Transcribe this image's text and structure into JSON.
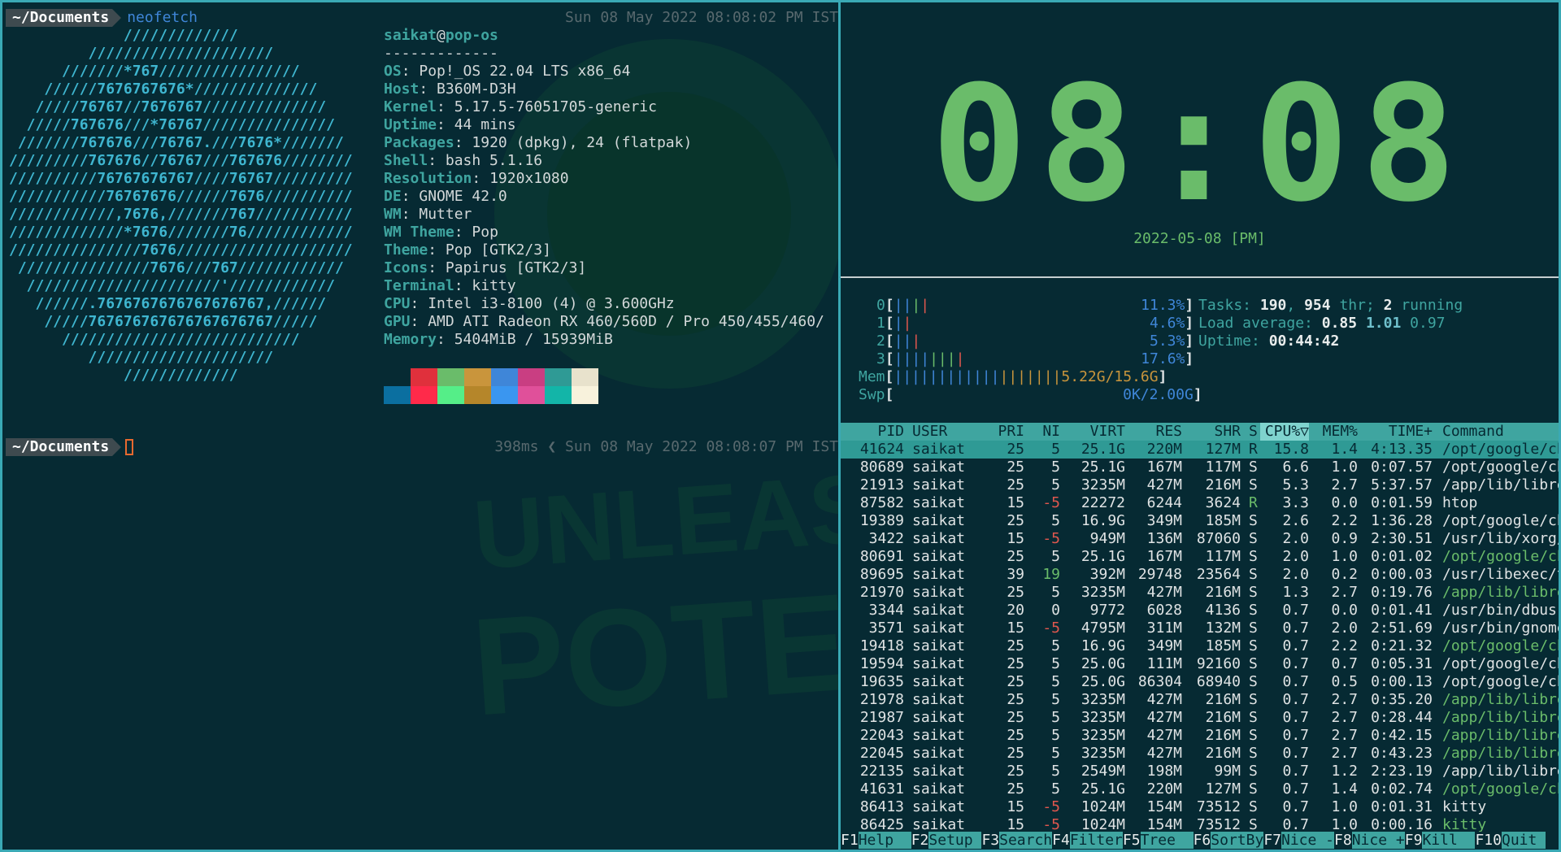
{
  "left_terminal": {
    "prompt_dir": "~/Documents",
    "command": "neofetch",
    "timestamp1": "Sun 08 May 2022 08:08:02 PM IST",
    "duration": "398ms",
    "timestamp2": "Sun 08 May 2022 08:08:07 PM IST",
    "separator_glyph": "❮",
    "ascii_art": [
      "             /////////////",
      "         /////////////////////",
      "      ///////*767////////////////",
      "    //////7676767676*//////////////",
      "   /////76767//7676767//////////////",
      "  /////767676///*76767///////////////",
      " ///////767676///76767.///7676*///////",
      "/////////767676//76767///767676////////",
      "//////////76767676767////76767/////////",
      "///////////76767676//////7676//////////",
      "////////////,7676,///////767///////////",
      "/////////////*7676///////76////////////",
      "///////////////7676////////////////////",
      " ///////////////7676///767////////////",
      "  //////////////////////'////////////",
      "   //////.7676767676767676767,//////",
      "    /////767676767676767676767/////",
      "      ///////////////////////////",
      "         /////////////////////",
      "             /////////////"
    ],
    "user": "saikat",
    "host": "pop-os",
    "divider": "-------------",
    "info": [
      {
        "key": "OS",
        "value": "Pop!_OS 22.04 LTS x86_64"
      },
      {
        "key": "Host",
        "value": "B360M-D3H"
      },
      {
        "key": "Kernel",
        "value": "5.17.5-76051705-generic"
      },
      {
        "key": "Uptime",
        "value": "44 mins"
      },
      {
        "key": "Packages",
        "value": "1920 (dpkg), 24 (flatpak)"
      },
      {
        "key": "Shell",
        "value": "bash 5.1.16"
      },
      {
        "key": "Resolution",
        "value": "1920x1080"
      },
      {
        "key": "DE",
        "value": "GNOME 42.0"
      },
      {
        "key": "WM",
        "value": "Mutter"
      },
      {
        "key": "WM Theme",
        "value": "Pop"
      },
      {
        "key": "Theme",
        "value": "Pop [GTK2/3]"
      },
      {
        "key": "Icons",
        "value": "Papirus [GTK2/3]"
      },
      {
        "key": "Terminal",
        "value": "kitty"
      },
      {
        "key": "CPU",
        "value": "Intel i3-8100 (4) @ 3.600GHz"
      },
      {
        "key": "GPU",
        "value": "AMD ATI Radeon RX 460/560D / Pro 450/455/460/"
      },
      {
        "key": "Memory",
        "value": "5404MiB / 15939MiB"
      }
    ],
    "palette_top": [
      "#062a33",
      "#e0303c",
      "#6abc6a",
      "#c9953c",
      "#3f86d8",
      "#c93e82",
      "#2f9a95",
      "#e8e2cc"
    ],
    "palette_bottom": [
      "#0b6fa0",
      "#ff2a4a",
      "#55ee88",
      "#b5862a",
      "#3a96f0",
      "#e0509a",
      "#13b5a8",
      "#f8f2dc"
    ],
    "watermark_text": [
      "UNLEASH YOUR",
      "POTENTIAL"
    ]
  },
  "clock": {
    "time": "08:08",
    "date": "2022-05-08 [PM]"
  },
  "htop": {
    "cpus": [
      {
        "id": "0",
        "pct": "11.3%",
        "fill": 0.113,
        "bars": "||||"
      },
      {
        "id": "1",
        "pct": "4.6%",
        "fill": 0.046,
        "bars": "||"
      },
      {
        "id": "2",
        "pct": "5.3%",
        "fill": 0.053,
        "bars": "|||"
      },
      {
        "id": "3",
        "pct": "17.6%",
        "fill": 0.176,
        "bars": "||||||||"
      }
    ],
    "mem": {
      "label": "Mem",
      "value": "5.22G/15.6G",
      "bars": "|||||||||||||||||||"
    },
    "swp": {
      "label": "Swp",
      "value": "0K/2.00G"
    },
    "tasks": {
      "label": "Tasks:",
      "count": "190",
      "thr": "954",
      "thr_label": "thr;",
      "running": "2",
      "running_label": "running"
    },
    "load": {
      "label": "Load average:",
      "v1": "0.85",
      "v2": "1.01",
      "v3": "0.97"
    },
    "uptime": {
      "label": "Uptime:",
      "value": "00:44:42"
    },
    "columns": {
      "pid": "PID",
      "user": "USER",
      "pri": "PRI",
      "ni": "NI",
      "virt": "VIRT",
      "res": "RES",
      "shr": "SHR",
      "s": "S",
      "cpu": "CPU%▽",
      "mem": "MEM%",
      "time": "TIME+",
      "cmd": "Command"
    },
    "processes": [
      {
        "pid": "41624",
        "user": "saikat",
        "pri": "25",
        "ni": "5",
        "virt": "25.1G",
        "res": "220M",
        "shr": "127M",
        "s": "R",
        "cpu": "15.8",
        "mem": "1.4",
        "time": "4:13.35",
        "cmd": "/opt/google/chr"
      },
      {
        "pid": "80689",
        "user": "saikat",
        "pri": "25",
        "ni": "5",
        "virt": "25.1G",
        "res": "167M",
        "shr": "117M",
        "s": "S",
        "cpu": "6.6",
        "mem": "1.0",
        "time": "0:07.57",
        "cmd": "/opt/google/chr"
      },
      {
        "pid": "21913",
        "user": "saikat",
        "pri": "25",
        "ni": "5",
        "virt": "3235M",
        "res": "427M",
        "shr": "216M",
        "s": "S",
        "cpu": "5.3",
        "mem": "2.7",
        "time": "5:37.57",
        "cmd": "/app/lib/librew"
      },
      {
        "pid": "87582",
        "user": "saikat",
        "pri": "15",
        "ni": "-5",
        "virt": "22272",
        "res": "6244",
        "shr": "3624",
        "s": "R",
        "cpu": "3.3",
        "mem": "0.0",
        "time": "0:01.59",
        "cmd": "htop"
      },
      {
        "pid": "19389",
        "user": "saikat",
        "pri": "25",
        "ni": "5",
        "virt": "16.9G",
        "res": "349M",
        "shr": "185M",
        "s": "S",
        "cpu": "2.6",
        "mem": "2.2",
        "time": "1:36.28",
        "cmd": "/opt/google/chr"
      },
      {
        "pid": "3422",
        "user": "saikat",
        "pri": "15",
        "ni": "-5",
        "virt": "949M",
        "res": "136M",
        "shr": "87060",
        "s": "S",
        "cpu": "2.0",
        "mem": "0.9",
        "time": "2:30.51",
        "cmd": "/usr/lib/xorg/X"
      },
      {
        "pid": "80691",
        "user": "saikat",
        "pri": "25",
        "ni": "5",
        "virt": "25.1G",
        "res": "167M",
        "shr": "117M",
        "s": "S",
        "cpu": "2.0",
        "mem": "1.0",
        "time": "0:01.02",
        "cmd": "/opt/google/chr"
      },
      {
        "pid": "89695",
        "user": "saikat",
        "pri": "39",
        "ni": "19",
        "virt": "392M",
        "res": "29748",
        "shr": "23564",
        "s": "S",
        "cpu": "2.0",
        "mem": "0.2",
        "time": "0:00.03",
        "cmd": "/usr/libexec/tr"
      },
      {
        "pid": "21970",
        "user": "saikat",
        "pri": "25",
        "ni": "5",
        "virt": "3235M",
        "res": "427M",
        "shr": "216M",
        "s": "S",
        "cpu": "1.3",
        "mem": "2.7",
        "time": "0:19.76",
        "cmd": "/app/lib/librew"
      },
      {
        "pid": "3344",
        "user": "saikat",
        "pri": "20",
        "ni": "0",
        "virt": "9772",
        "res": "6028",
        "shr": "4136",
        "s": "S",
        "cpu": "0.7",
        "mem": "0.0",
        "time": "0:01.41",
        "cmd": "/usr/bin/dbus-d"
      },
      {
        "pid": "3571",
        "user": "saikat",
        "pri": "15",
        "ni": "-5",
        "virt": "4795M",
        "res": "311M",
        "shr": "132M",
        "s": "S",
        "cpu": "0.7",
        "mem": "2.0",
        "time": "2:51.69",
        "cmd": "/usr/bin/gnome-"
      },
      {
        "pid": "19418",
        "user": "saikat",
        "pri": "25",
        "ni": "5",
        "virt": "16.9G",
        "res": "349M",
        "shr": "185M",
        "s": "S",
        "cpu": "0.7",
        "mem": "2.2",
        "time": "0:21.32",
        "cmd": "/opt/google/chr"
      },
      {
        "pid": "19594",
        "user": "saikat",
        "pri": "25",
        "ni": "5",
        "virt": "25.0G",
        "res": "111M",
        "shr": "92160",
        "s": "S",
        "cpu": "0.7",
        "mem": "0.7",
        "time": "0:05.31",
        "cmd": "/opt/google/chr"
      },
      {
        "pid": "19635",
        "user": "saikat",
        "pri": "25",
        "ni": "5",
        "virt": "25.0G",
        "res": "86304",
        "shr": "68940",
        "s": "S",
        "cpu": "0.7",
        "mem": "0.5",
        "time": "0:00.13",
        "cmd": "/opt/google/chr"
      },
      {
        "pid": "21978",
        "user": "saikat",
        "pri": "25",
        "ni": "5",
        "virt": "3235M",
        "res": "427M",
        "shr": "216M",
        "s": "S",
        "cpu": "0.7",
        "mem": "2.7",
        "time": "0:35.20",
        "cmd": "/app/lib/librew"
      },
      {
        "pid": "21987",
        "user": "saikat",
        "pri": "25",
        "ni": "5",
        "virt": "3235M",
        "res": "427M",
        "shr": "216M",
        "s": "S",
        "cpu": "0.7",
        "mem": "2.7",
        "time": "0:28.44",
        "cmd": "/app/lib/librew"
      },
      {
        "pid": "22043",
        "user": "saikat",
        "pri": "25",
        "ni": "5",
        "virt": "3235M",
        "res": "427M",
        "shr": "216M",
        "s": "S",
        "cpu": "0.7",
        "mem": "2.7",
        "time": "0:42.15",
        "cmd": "/app/lib/librew"
      },
      {
        "pid": "22045",
        "user": "saikat",
        "pri": "25",
        "ni": "5",
        "virt": "3235M",
        "res": "427M",
        "shr": "216M",
        "s": "S",
        "cpu": "0.7",
        "mem": "2.7",
        "time": "0:43.23",
        "cmd": "/app/lib/librew"
      },
      {
        "pid": "22135",
        "user": "saikat",
        "pri": "25",
        "ni": "5",
        "virt": "2549M",
        "res": "198M",
        "shr": "99M",
        "s": "S",
        "cpu": "0.7",
        "mem": "1.2",
        "time": "2:23.19",
        "cmd": "/app/lib/librew"
      },
      {
        "pid": "41631",
        "user": "saikat",
        "pri": "25",
        "ni": "5",
        "virt": "25.1G",
        "res": "220M",
        "shr": "127M",
        "s": "S",
        "cpu": "0.7",
        "mem": "1.4",
        "time": "0:02.74",
        "cmd": "/opt/google/chr"
      },
      {
        "pid": "86413",
        "user": "saikat",
        "pri": "15",
        "ni": "-5",
        "virt": "1024M",
        "res": "154M",
        "shr": "73512",
        "s": "S",
        "cpu": "0.7",
        "mem": "1.0",
        "time": "0:01.31",
        "cmd": "kitty"
      },
      {
        "pid": "86425",
        "user": "saikat",
        "pri": "15",
        "ni": "-5",
        "virt": "1024M",
        "res": "154M",
        "shr": "73512",
        "s": "S",
        "cpu": "0.7",
        "mem": "1.0",
        "time": "0:00.16",
        "cmd": "kitty"
      }
    ],
    "fkeys": [
      {
        "key": "F1",
        "label": "Help  "
      },
      {
        "key": "F2",
        "label": "Setup "
      },
      {
        "key": "F3",
        "label": "Search"
      },
      {
        "key": "F4",
        "label": "Filter"
      },
      {
        "key": "F5",
        "label": "Tree  "
      },
      {
        "key": "F6",
        "label": "SortBy"
      },
      {
        "key": "F7",
        "label": "Nice -"
      },
      {
        "key": "F8",
        "label": "Nice +"
      },
      {
        "key": "F9",
        "label": "Kill  "
      },
      {
        "key": "F10",
        "label": "Quit "
      }
    ]
  }
}
